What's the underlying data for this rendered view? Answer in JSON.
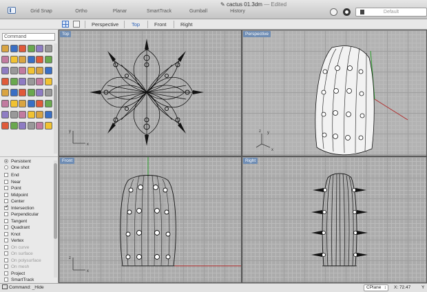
{
  "titlebar": {
    "doc_name": "cactus 01.3dm",
    "doc_status": "— Edited",
    "modes": [
      {
        "label": "Grid Snap",
        "on": true
      },
      {
        "label": "Ortho",
        "on": false
      },
      {
        "label": "Planar",
        "on": true
      },
      {
        "label": "SmartTrack",
        "on": false
      },
      {
        "label": "Gumball",
        "on": false
      },
      {
        "label": "History",
        "on": true
      }
    ],
    "layer": "Default"
  },
  "viewport_tabs": [
    "Perspective",
    "Top",
    "Front",
    "Right"
  ],
  "active_tab": "Top",
  "left_panel": {
    "search_placeholder": "Command",
    "tools": [
      "point-tool-icon",
      "polyline-tool-icon",
      "rectangle-tool-icon",
      "circle-tool-icon",
      "arc-tool-icon",
      "curve-tool-icon",
      "fillet-tool-icon",
      "trim-tool-icon",
      "split-tool-icon",
      "join-tool-icon",
      "explode-tool-icon",
      "offset-tool-icon",
      "extrude-tool-icon",
      "loft-tool-icon",
      "revolve-tool-icon",
      "sweep-tool-icon",
      "boolean-union-icon",
      "boolean-difference-icon",
      "box-tool-icon",
      "sphere-tool-icon",
      "cylinder-tool-icon",
      "cone-tool-icon",
      "pipe-tool-icon",
      "patch-tool-icon",
      "shell-tool-icon",
      "check-tool-icon",
      "move-tool-icon",
      "rotate-tool-icon",
      "scale-tool-icon",
      "mirror-tool-icon",
      "array-tool-icon",
      "zoom-tool-icon",
      "pan-tool-icon",
      "orbit-tool-icon",
      "distance-tool-icon",
      "text-tool-icon",
      "dimension-tool-icon",
      "hatch-tool-icon",
      "layer-tool-icon",
      "material-tool-icon",
      "render-tool-icon",
      "color-wheel-icon",
      "light-tool-icon",
      "camera-tool-icon",
      "record-tool-icon",
      "globe-tool-icon",
      "curvature-tool-icon",
      "layout-tool-icon"
    ],
    "osnap_mode": [
      {
        "label": "Persistent",
        "on": true
      },
      {
        "label": "One shot",
        "on": false
      }
    ],
    "osnaps": [
      {
        "label": "End",
        "checked": false,
        "disabled": false
      },
      {
        "label": "Near",
        "checked": false,
        "disabled": false
      },
      {
        "label": "Point",
        "checked": false,
        "disabled": false
      },
      {
        "label": "Midpoint",
        "checked": false,
        "disabled": false
      },
      {
        "label": "Center",
        "checked": false,
        "disabled": false
      },
      {
        "label": "Intersection",
        "checked": true,
        "disabled": false
      },
      {
        "label": "Perpendicular",
        "checked": false,
        "disabled": false
      },
      {
        "label": "Tangent",
        "checked": false,
        "disabled": false
      },
      {
        "label": "Quadrant",
        "checked": false,
        "disabled": false
      },
      {
        "label": "Knot",
        "checked": false,
        "disabled": false
      },
      {
        "label": "Vertex",
        "checked": false,
        "disabled": false
      },
      {
        "label": "On curve",
        "checked": false,
        "disabled": true
      },
      {
        "label": "On surface",
        "checked": false,
        "disabled": true
      },
      {
        "label": "On polysurface",
        "checked": false,
        "disabled": true
      },
      {
        "label": "On mesh",
        "checked": false,
        "disabled": true
      },
      {
        "label": "Project",
        "checked": false,
        "disabled": false
      },
      {
        "label": "SmartTrack",
        "checked": false,
        "disabled": false
      }
    ]
  },
  "viewports": {
    "top": "Top",
    "perspective": "Perspective",
    "front": "Front",
    "right": "Right"
  },
  "axis_labels": {
    "x": "x",
    "y": "y",
    "z": "z"
  },
  "statusbar": {
    "command": "Command: _Hide",
    "cplane": "CPlane",
    "x": "X: 72.47",
    "y": "Y"
  },
  "colors": {
    "accent": "#2d63b8",
    "vp_label": "#6f8db4",
    "x_axis": "#b02a2a",
    "y_axis": "#2ca02c"
  }
}
